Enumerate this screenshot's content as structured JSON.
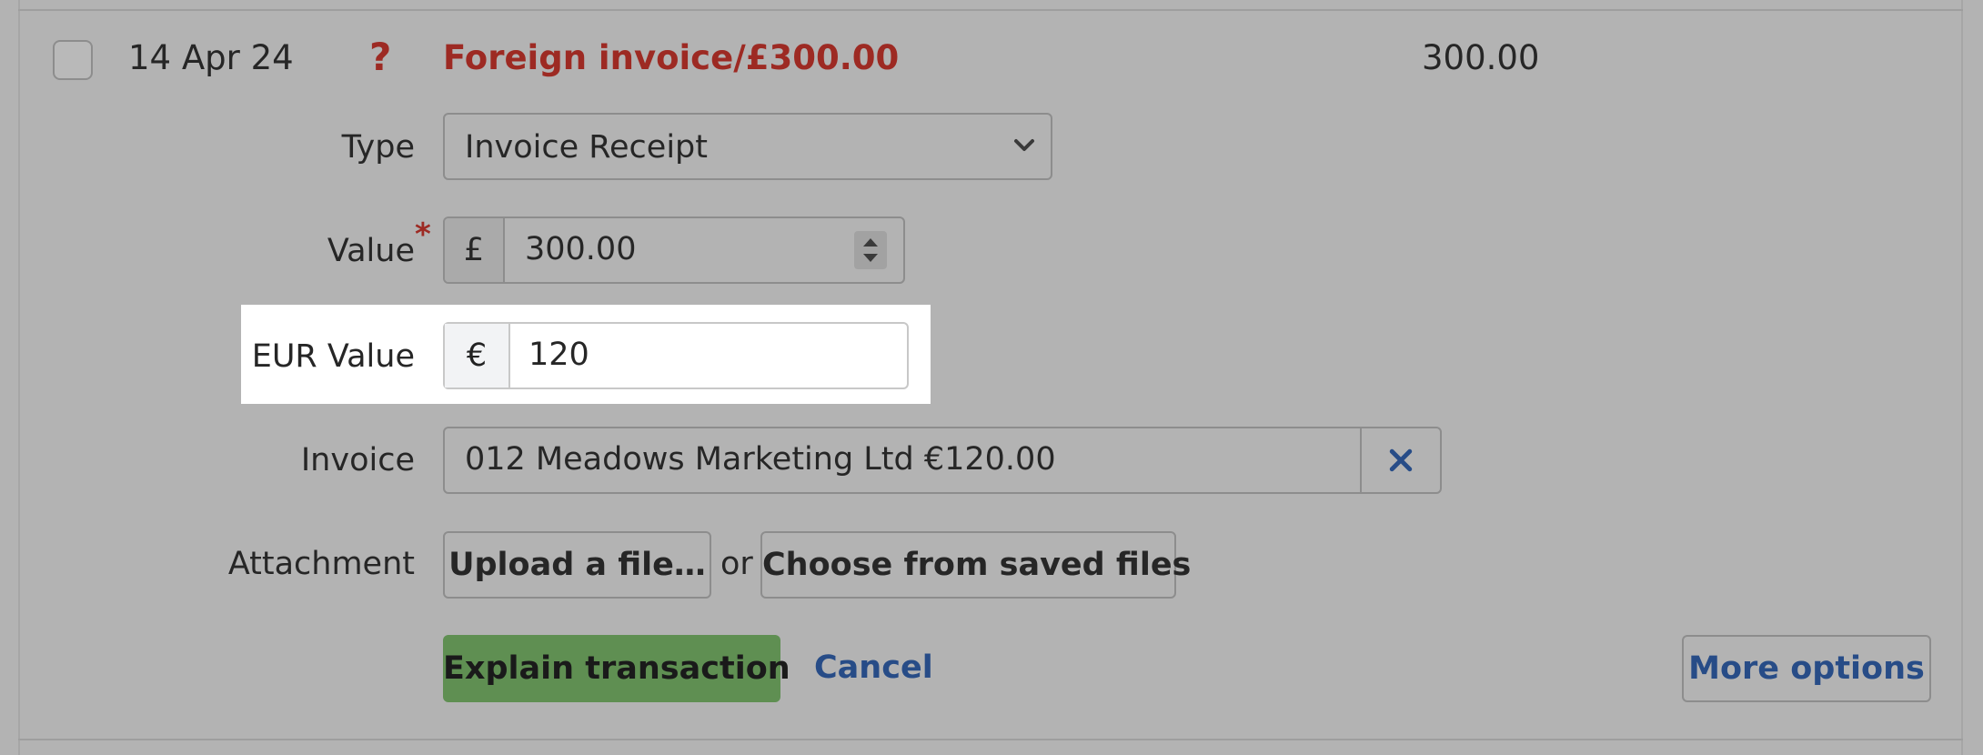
{
  "transaction": {
    "date": "14 Apr 24",
    "status_glyph": "?",
    "description": "Foreign invoice/£300.00",
    "amount": "300.00"
  },
  "form": {
    "type": {
      "label": "Type",
      "value": "Invoice Receipt"
    },
    "value": {
      "label": "Value",
      "required_mark": "*",
      "currency_symbol": "£",
      "amount": "300.00"
    },
    "eur_value": {
      "label": "EUR Value",
      "currency_symbol": "€",
      "amount": "120"
    },
    "invoice": {
      "label": "Invoice",
      "value": "012 Meadows Marketing Ltd €120.00",
      "clear_glyph": "✕"
    },
    "attachment": {
      "label": "Attachment",
      "upload_label": "Upload a file…",
      "or_text": "or",
      "saved_files_label": "Choose from saved files"
    }
  },
  "actions": {
    "explain_label": "Explain transaction",
    "cancel_label": "Cancel",
    "more_options_label": "More options"
  },
  "colors": {
    "overlay": "#b3b3b3",
    "error_red": "#9d2a23",
    "primary_green": "#5f8f52",
    "link_blue": "#274c87",
    "highlight": "#ffffff"
  },
  "icons": {
    "status": "question-mark-icon",
    "select": "chevron-down-icon",
    "value_spin": "stepper-icon",
    "invoice_clear": "close-icon"
  }
}
